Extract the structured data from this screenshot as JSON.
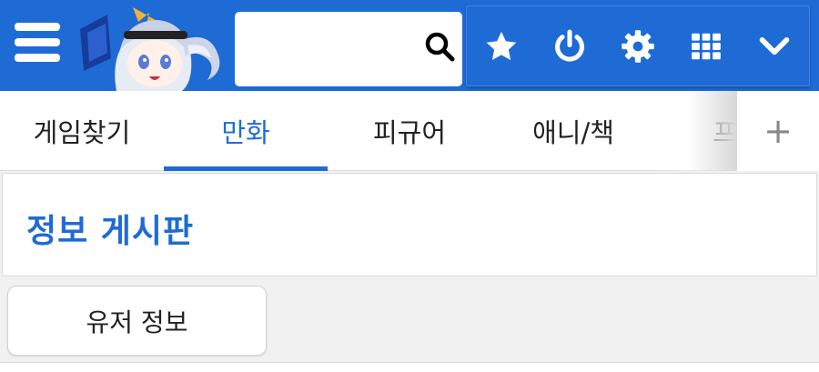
{
  "header": {
    "search": {
      "value": "",
      "placeholder": ""
    },
    "icons": [
      "menu-icon",
      "search-icon",
      "star-icon",
      "power-icon",
      "gear-icon",
      "grid-icon",
      "chevron-down-icon"
    ]
  },
  "tabs": [
    {
      "label": "게임찾기",
      "active": false
    },
    {
      "label": "만화",
      "active": true
    },
    {
      "label": "피규어",
      "active": false
    },
    {
      "label": "애니/책",
      "active": false
    },
    {
      "label": "프라",
      "active": false
    }
  ],
  "tab_add_label": "+",
  "board": {
    "title": "정보 게시판"
  },
  "sub_button_label": "유저 정보",
  "colors": {
    "primary": "#1e6bd6",
    "background": "#f1f1f1",
    "panel": "#ffffff"
  }
}
